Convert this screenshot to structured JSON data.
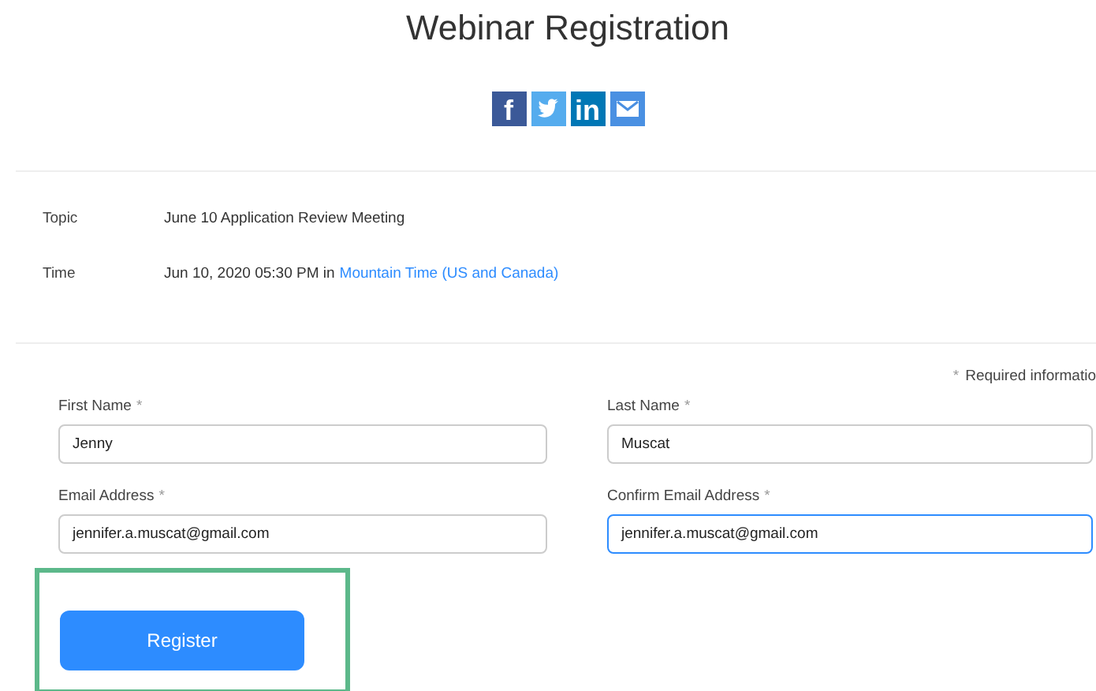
{
  "title": "Webinar Registration",
  "share_buttons": [
    {
      "kind": "facebook",
      "label": "f"
    },
    {
      "kind": "twitter"
    },
    {
      "kind": "linkedin",
      "label": "in"
    },
    {
      "kind": "email"
    }
  ],
  "details": [
    {
      "label": "Topic",
      "value": "June 10 Application Review Meeting"
    },
    {
      "label": "Time",
      "value": "Jun 10, 2020 05:30 PM in",
      "link": "Mountain Time (US and Canada)"
    }
  ],
  "required_note": {
    "mark": "*",
    "text": "Required informatio"
  },
  "fields": [
    {
      "label": "First Name",
      "mark": "*",
      "value": "Jenny",
      "focused": false
    },
    {
      "label": "Last Name",
      "mark": "*",
      "value": "Muscat",
      "focused": false
    },
    {
      "label": "Email Address",
      "mark": "*",
      "value": "jennifer.a.muscat@gmail.com",
      "focused": false
    },
    {
      "label": "Confirm Email Address",
      "mark": "*",
      "value": "jennifer.a.muscat@gmail.com",
      "focused": true
    }
  ],
  "register_button": {
    "label": "Register",
    "highlighted": true
  }
}
